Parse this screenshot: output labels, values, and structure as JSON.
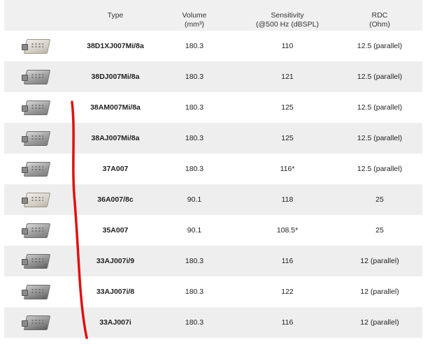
{
  "table": {
    "headers": {
      "type": "Type",
      "volume_line1": "Volume",
      "volume_line2": "(mm³)",
      "sensitivity_line1": "Sensitivity",
      "sensitivity_line2": "(@500 Hz (dBSPL)",
      "rdc_line1": "RDC",
      "rdc_line2": "(Ohm)"
    },
    "rows": [
      {
        "type": "38D1XJ007Mi/8a",
        "volume": "180.3",
        "sensitivity": "110",
        "rdc": "12.5 (parallel)",
        "image": "receiver-thumb-icon"
      },
      {
        "type": "38DJ007Mi/8a",
        "volume": "180.3",
        "sensitivity": "121",
        "rdc": "12.5 (parallel)",
        "image": "receiver-thumb-icon"
      },
      {
        "type": "38AM007Mi/8a",
        "volume": "180.3",
        "sensitivity": "125",
        "rdc": "12.5 (parallel)",
        "image": "receiver-thumb-icon"
      },
      {
        "type": "38AJ007Mi/8a",
        "volume": "180.3",
        "sensitivity": "125",
        "rdc": "12.5 (parallel)",
        "image": "receiver-thumb-icon"
      },
      {
        "type": "37A007",
        "volume": "180.3",
        "sensitivity": "116*",
        "rdc": "12.5 (parallel)",
        "image": "receiver-thumb-icon"
      },
      {
        "type": "36A007/8c",
        "volume": "90.1",
        "sensitivity": "118",
        "rdc": "25",
        "image": "receiver-thumb-icon"
      },
      {
        "type": "35A007",
        "volume": "90.1",
        "sensitivity": "108.5*",
        "rdc": "25",
        "image": "receiver-thumb-icon"
      },
      {
        "type": "33AJ007i/9",
        "volume": "180.3",
        "sensitivity": "116",
        "rdc": "12 (parallel)",
        "image": "receiver-thumb-icon"
      },
      {
        "type": "33AJ007i/8",
        "volume": "180.3",
        "sensitivity": "122",
        "rdc": "12 (parallel)",
        "image": "receiver-thumb-icon"
      },
      {
        "type": "33AJ007i",
        "volume": "180.3",
        "sensitivity": "116",
        "rdc": "12 (parallel)",
        "image": "receiver-thumb-icon"
      }
    ]
  },
  "annotation": {
    "color": "#e01010"
  }
}
